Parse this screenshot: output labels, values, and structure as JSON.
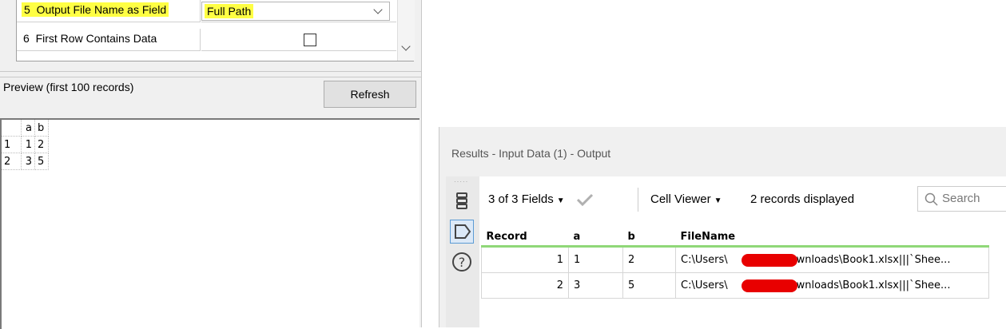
{
  "config": {
    "rows": [
      {
        "num": "5",
        "label": "Output File Name as Field",
        "value": "Full Path"
      },
      {
        "num": "6",
        "label": "First Row Contains Data",
        "value": ""
      }
    ],
    "highlight_color": "#ffff44"
  },
  "preview": {
    "label": "Preview (first 100 records)",
    "refresh_label": "Refresh",
    "headers": [
      "",
      "a",
      "b"
    ],
    "rows": [
      [
        "1",
        "1",
        "2"
      ],
      [
        "2",
        "3",
        "5"
      ]
    ]
  },
  "results": {
    "title": "Results - Input Data (1) - Output",
    "fields_label": "3 of 3 Fields",
    "cell_viewer_label": "Cell Viewer",
    "records_label": "2 records displayed",
    "search_placeholder": "Search",
    "columns": [
      "Record",
      "a",
      "b",
      "FileName"
    ],
    "rows": [
      {
        "record": "1",
        "a": "1",
        "b": "2",
        "file_pre": "C:\\Users\\",
        "file_post": "Downloads\\Book1.xlsx|||`Shee..."
      },
      {
        "record": "2",
        "a": "3",
        "b": "5",
        "file_pre": "C:\\Users\\",
        "file_post": "Downloads\\Book1.xlsx|||`Shee..."
      }
    ],
    "accent_color": "#8fd878"
  }
}
